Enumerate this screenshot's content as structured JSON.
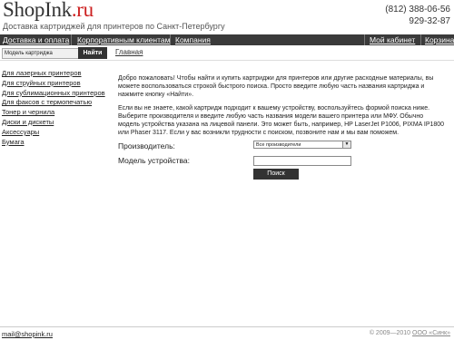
{
  "header": {
    "logo_main": "ShopInk",
    "logo_ext": ".ru",
    "tagline": "Доставка картриджей для принтеров по Санкт-Петербургу",
    "phone_1": "(812) 388-06-56",
    "phone_2": "929-32-87"
  },
  "topnav": {
    "delivery": "Доставка и оплата",
    "corporate": "Корпоративным клиентам",
    "company": "Компания",
    "cabinet": "Мой кабинет",
    "cart": "Корзина"
  },
  "search": {
    "value": "Модель картриджа",
    "button": "Найти"
  },
  "breadcrumb": "Главная",
  "sidebar": {
    "items": [
      "Для лазерных принтеров",
      "Для струйных принтеров",
      "Для сублимационных принтеров",
      "Для факсов с термопечатью",
      "Тонер и чернила",
      "Диски и дискеты",
      "Аксессуары",
      "Бумага"
    ]
  },
  "content": {
    "intro": "Добро пожаловать! Чтобы найти и купить картриджи для принтеров или другие расходные материалы, вы можете воспользоваться строкой быстрого поиска. Просто введите любую часть названия картриджа и нажмите кнопку «Найти».",
    "help": "Если вы не знаете, какой картридж подходит к вашему устройству, воспользуйтесь формой поиска ниже. Выберите производителя и введите любую часть названия модели вашего принтера или МФУ. Обычно модель устройства указана на лицевой панели. Это может быть, например, HP LaserJet P1006, PIXMA IP1800 или Phaser 3117. Если у вас возникли трудности с поиском, позвоните нам и мы вам поможем."
  },
  "form": {
    "manufacturer_label": "Производитель:",
    "manufacturer_value": "Все производители",
    "model_label": "Модель устройства:",
    "model_value": "",
    "submit": "Поиск"
  },
  "footer": {
    "email": "mail@shopink.ru",
    "copyright": "© 2009—2010",
    "company": "ООО «Синк»"
  }
}
